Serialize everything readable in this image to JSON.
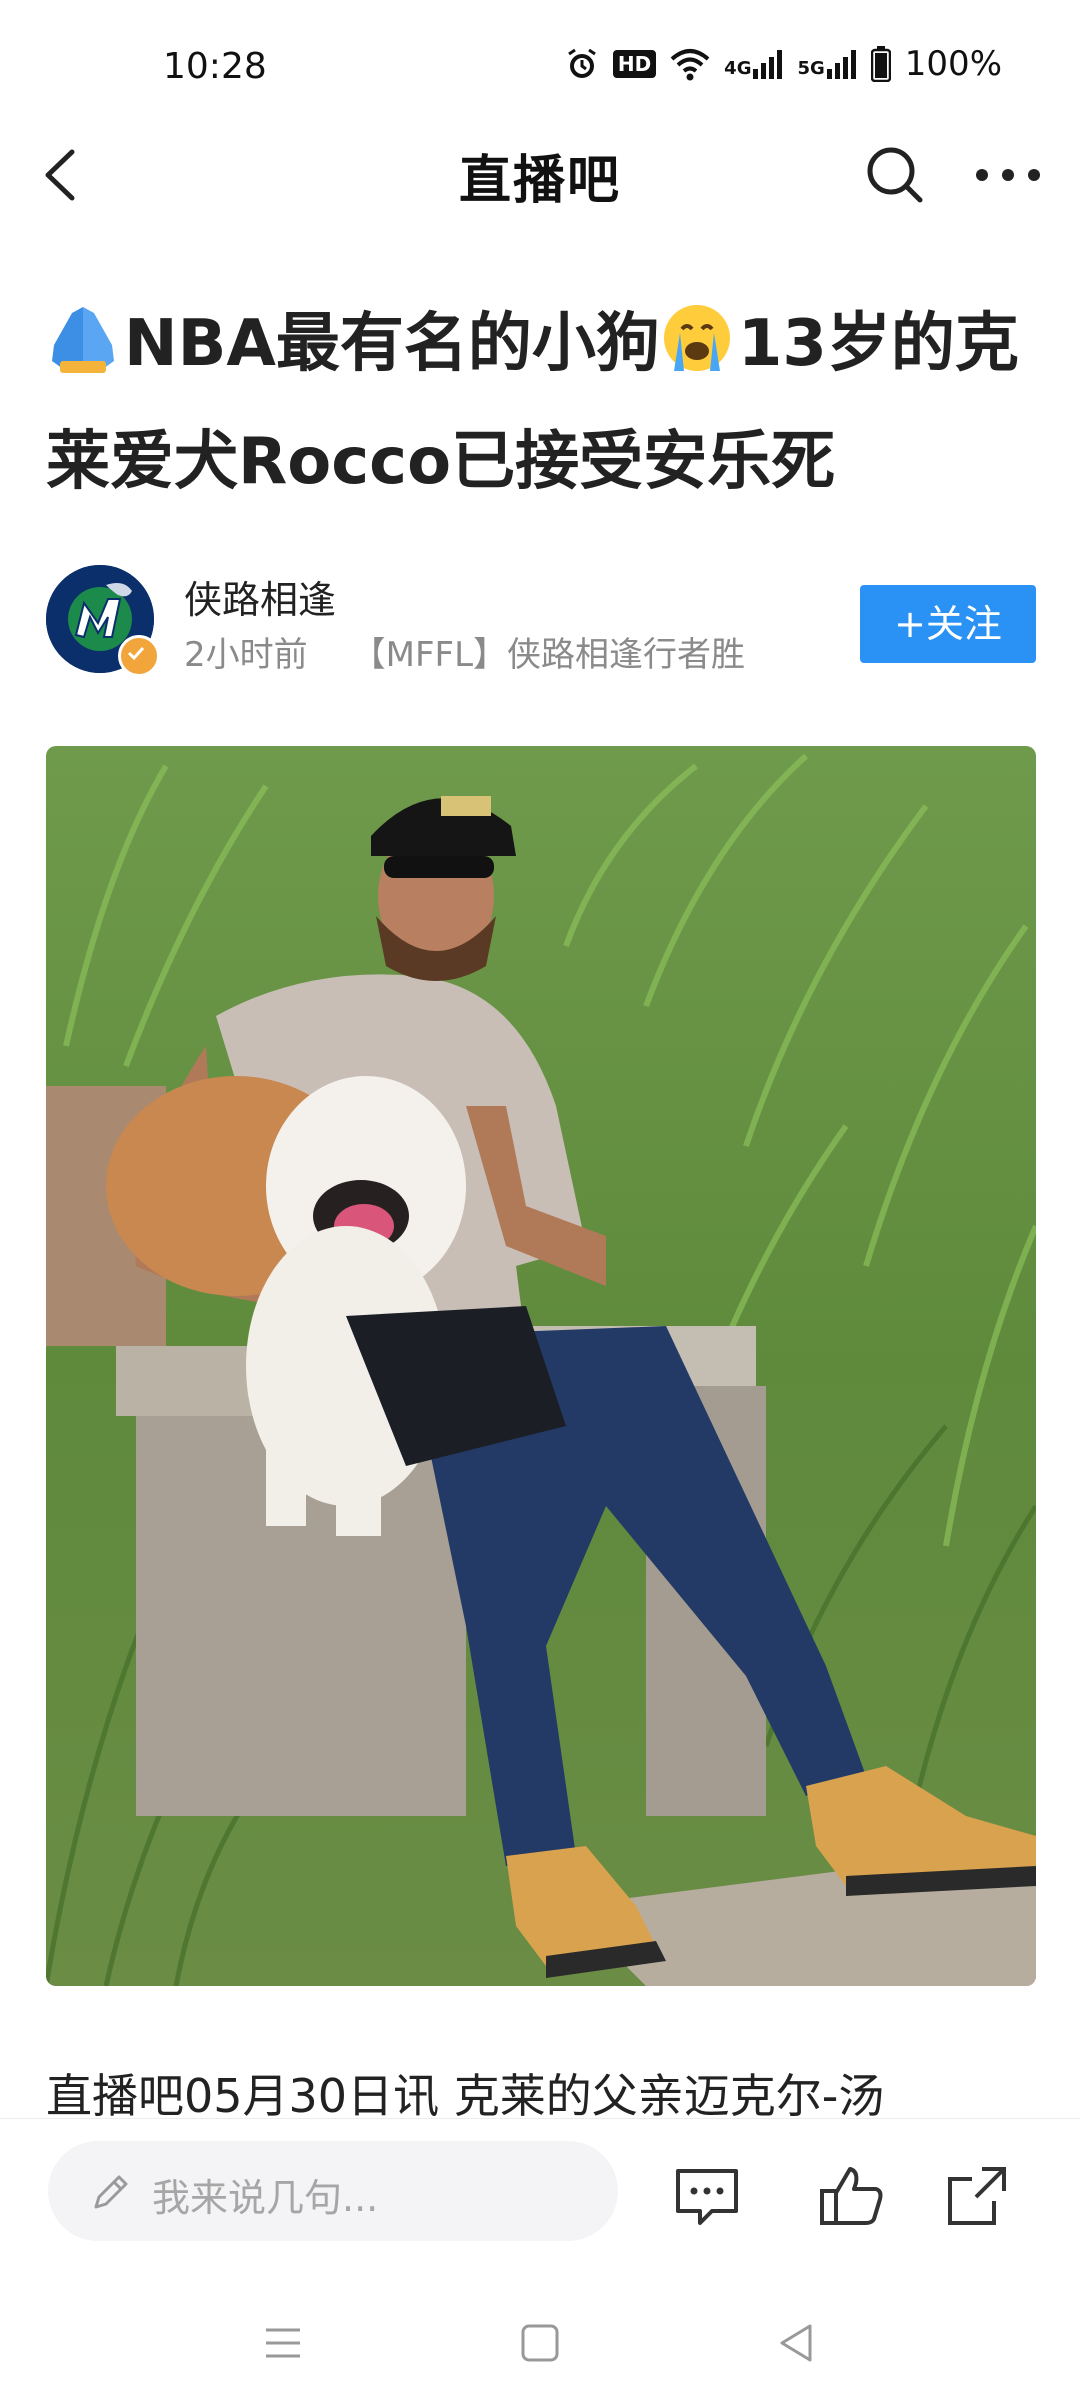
{
  "status_bar": {
    "time": "10:28",
    "network_4g": "4G",
    "network_5g": "5G",
    "hd": "HD",
    "battery": "100%"
  },
  "nav": {
    "title": "直播吧"
  },
  "article": {
    "headline_part1": "NBA最有名的小狗",
    "headline_part2": "13岁的克莱爱犬Rocco已接受安乐死",
    "body_preview": "直播吧05月30日讯 克莱的父亲迈克尔-汤"
  },
  "author": {
    "name": "侠路相逢",
    "time": "2小时前",
    "signature": "【MFFL】侠路相逢行者胜",
    "follow_label": "+关注"
  },
  "bottom_bar": {
    "comment_placeholder": "我来说几句..."
  },
  "colors": {
    "accent": "#2b92f5",
    "avatar_bg": "#0a2f6b",
    "badge": "#f2a53a"
  }
}
